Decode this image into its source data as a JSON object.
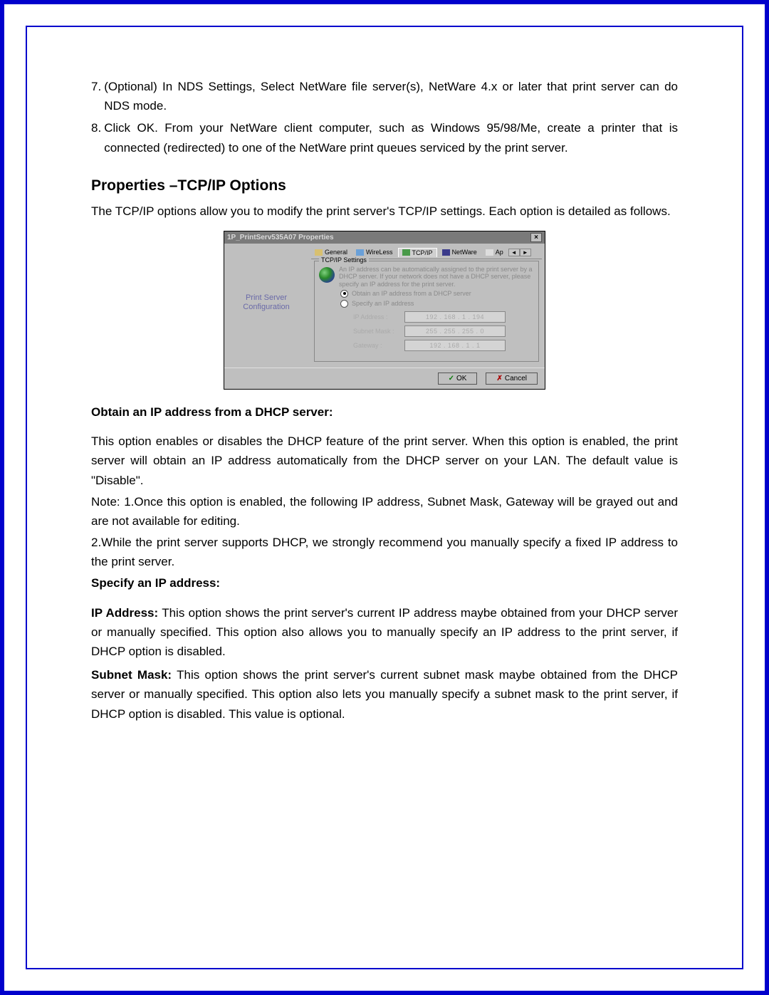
{
  "steps": {
    "s7_num": "7.",
    "s7_text": "(Optional) In NDS Settings, Select NetWare file server(s), NetWare 4.x or later that print server can do NDS mode.",
    "s8_num": "8.",
    "s8_text": "Click OK. From your NetWare client computer, such as Windows 95/98/Me, create a printer that is connected (redirected) to one of the NetWare print queues serviced by the print server."
  },
  "heading": "Properties –TCP/IP Options",
  "intro": "The TCP/IP options allow you to modify the print server's TCP/IP settings. Each option is detailed as follows.",
  "dialog": {
    "title": "1P_PrintServ535A07 Properties",
    "tabs": {
      "general": "General",
      "wireless": "WireLess",
      "tcpip": "TCP/IP",
      "netware": "NetWare",
      "apple_prefix": "Ap"
    },
    "left": {
      "l1": "Print Server",
      "l2": "Configuration"
    },
    "group": {
      "legend": "TCP/IP Settings",
      "desc": "An IP address can be automatically assigned to the print server by a DHCP server. If your network does not have a DHCP server, please specify an IP address for the print server.",
      "radio_dhcp": "Obtain an IP address from a DHCP server",
      "radio_specify": "Specify an IP address",
      "ip_label": "IP Address :",
      "ip_value": "192 . 168 .   1  . 194",
      "mask_label": "Subnet Mask :",
      "mask_value": "255 . 255 . 255 .   0",
      "gw_label": "Gateway :",
      "gw_value": "192 . 168 .   1  .   1"
    },
    "buttons": {
      "ok": "OK",
      "cancel": "Cancel"
    }
  },
  "below": {
    "obtain_heading": "Obtain an IP address from a DHCP server:",
    "obtain_para": "This option enables or disables the DHCP feature of the print server. When this option is enabled, the print server will obtain an IP address automatically from the DHCP server on your LAN. The default value is \"Disable\".",
    "note1": "Note: 1.Once this option is enabled, the following IP address, Subnet Mask, Gateway will be grayed out and are not available for editing.",
    "note2": "2.While the print server supports DHCP, we strongly recommend you manually specify a fixed IP address to the print server.",
    "specify_heading": "Specify an IP address:",
    "ipaddr_label": "IP Address:",
    "ipaddr_text": " This option shows the print server's current IP address maybe obtained from your DHCP server or manually specified. This option also allows you to manually specify an IP address to the print server, if DHCP option is disabled.",
    "subnet_label": "Subnet Mask:",
    "subnet_text": " This option shows the print server's current subnet mask maybe obtained from the DHCP server or manually specified. This option also lets you manually specify a subnet mask to the print server, if DHCP option is disabled. This value is optional."
  }
}
